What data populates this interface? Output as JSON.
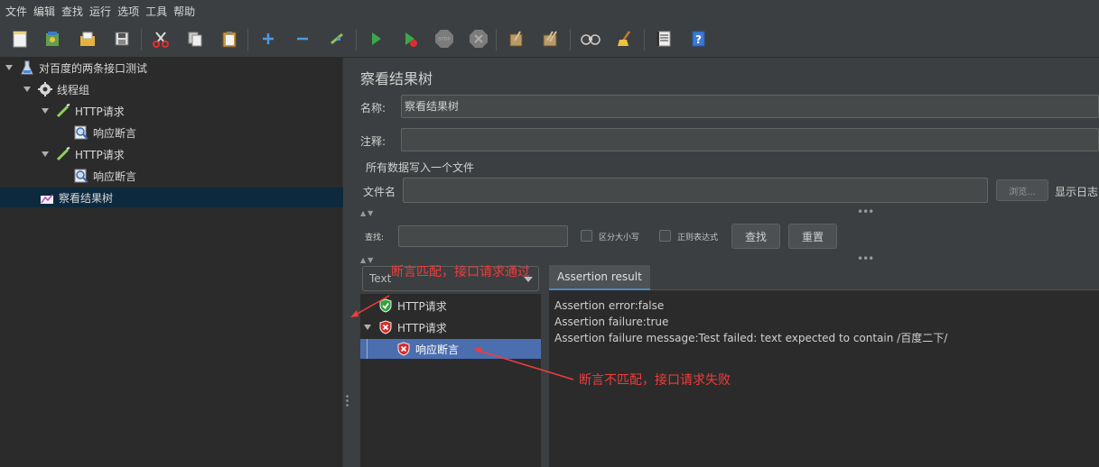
{
  "menu": [
    "文件",
    "编辑",
    "查找",
    "运行",
    "选项",
    "工具",
    "帮助"
  ],
  "toolbar": {
    "icons": [
      "new-file-icon",
      "templates-icon",
      "open-icon",
      "save-icon",
      "cut-icon",
      "copy-icon",
      "paste-icon",
      "expand-icon",
      "collapse-icon",
      "toggle-icon",
      "start-icon",
      "start-no-pause-icon",
      "stop-icon",
      "shutdown-icon",
      "clear-icon",
      "clear-all-icon",
      "search-icon",
      "reset-search-icon",
      "function-helper-icon",
      "help-icon"
    ]
  },
  "tree": {
    "root": "对百度的两条接口测试",
    "thread_group": "线程组",
    "http1": "HTTP请求",
    "assert1": "响应断言",
    "http2": "HTTP请求",
    "assert2": "响应断言",
    "listener": "察看结果树"
  },
  "panel": {
    "title": "察看结果树",
    "name_label": "名称:",
    "name_value": "察看结果树",
    "comment_label": "注释:",
    "comment_value": "",
    "group_title": "所有数据写入一个文件",
    "filename_label": "文件名",
    "filename_value": "",
    "browse_button": "浏览...",
    "show_log_label": "显示日志"
  },
  "search": {
    "label": "查找:",
    "value": "",
    "case_label": "区分大小写",
    "regex_label": "正则表达式",
    "find_button": "查找",
    "reset_button": "重置"
  },
  "results": {
    "renderer": "Text",
    "items": [
      {
        "label": "HTTP请求",
        "status": "pass"
      },
      {
        "label": "HTTP请求",
        "status": "fail"
      },
      {
        "label": "响应断言",
        "status": "fail"
      }
    ],
    "tab": "Assertion result",
    "lines": [
      "Assertion error:false",
      "Assertion failure:true",
      "Assertion failure message:Test failed: text expected to contain /百度二下/"
    ]
  },
  "annotations": {
    "pass": "断言匹配，接口请求通过",
    "fail": "断言不匹配，接口请求失败"
  },
  "colors": {
    "annotation": "#f03c3c",
    "selection": "#4b6eaf",
    "tree_selection": "#0d293e"
  }
}
